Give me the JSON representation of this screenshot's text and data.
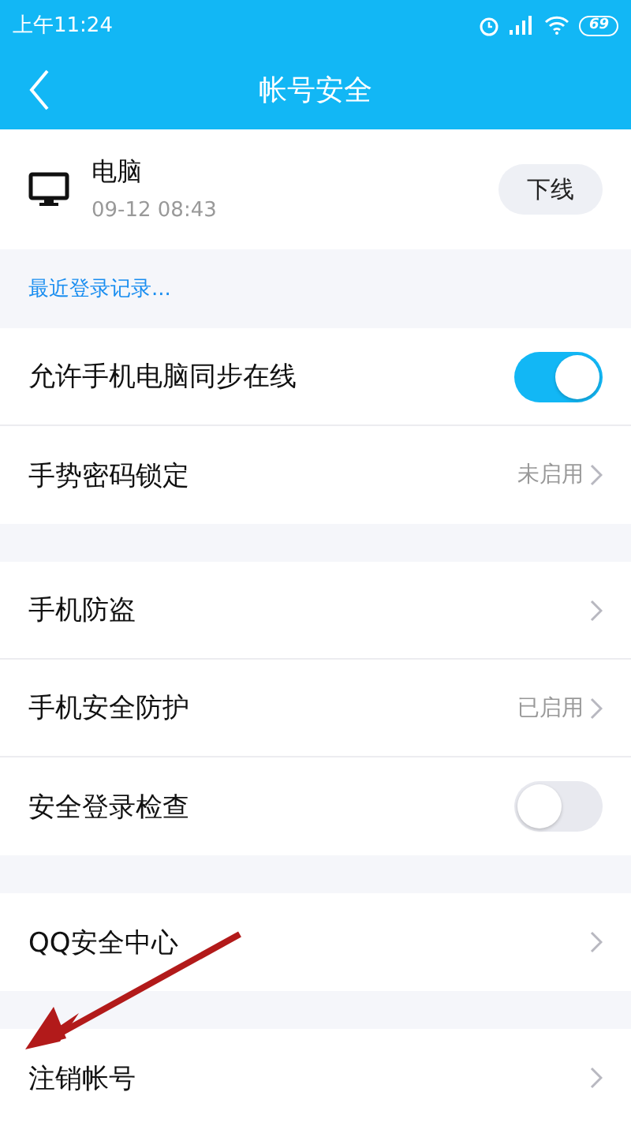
{
  "status_bar": {
    "time": "上午11:24",
    "battery": "69"
  },
  "header": {
    "title": "帐号安全"
  },
  "device": {
    "name": "电脑",
    "time": "09-12 08:43",
    "action": "下线"
  },
  "recent_link": "最近登录记录...",
  "groups": [
    {
      "rows": [
        {
          "kind": "toggle",
          "label": "允许手机电脑同步在线",
          "on": true
        },
        {
          "kind": "link",
          "label": "手势密码锁定",
          "value": "未启用"
        }
      ]
    },
    {
      "rows": [
        {
          "kind": "link",
          "label": "手机防盗"
        },
        {
          "kind": "link",
          "label": "手机安全防护",
          "value": "已启用"
        },
        {
          "kind": "toggle",
          "label": "安全登录检查",
          "on": false
        }
      ]
    },
    {
      "rows": [
        {
          "kind": "link",
          "label": "QQ安全中心"
        }
      ]
    },
    {
      "rows": [
        {
          "kind": "link",
          "label": "注销帐号"
        }
      ]
    }
  ]
}
